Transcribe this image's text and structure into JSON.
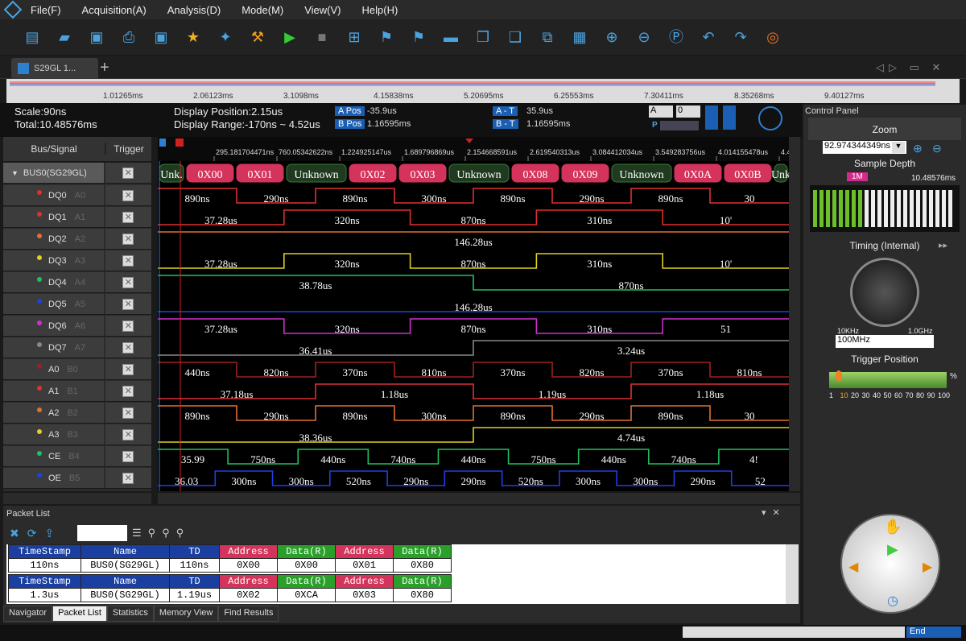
{
  "menu": [
    "File(F)",
    "Acquisition(A)",
    "Analysis(D)",
    "Mode(M)",
    "View(V)",
    "Help(H)"
  ],
  "toolbar_icons": [
    "new-file-icon",
    "open-folder-icon",
    "save-icon",
    "print-icon",
    "save-as-icon",
    "star-icon",
    "settings-icon",
    "tools-icon",
    "run-icon",
    "stop-icon",
    "add-marker-icon",
    "flag-icon",
    "flag-down-icon",
    "flashlight-icon",
    "copy-icon",
    "paste-icon",
    "compare-icon",
    "binary-icon",
    "zoom-in-icon",
    "zoom-out-icon",
    "zoom-fit-icon",
    "undo-icon",
    "redo-icon",
    "help-ring-icon"
  ],
  "tab": {
    "label": "S29GL 1...",
    "plus": "+"
  },
  "overview_ticks": [
    "1.01265ms",
    "2.06123ms",
    "3.1098ms",
    "4.15838ms",
    "5.20695ms",
    "6.25553ms",
    "7.30411ms",
    "8.35268ms",
    "9.40127ms"
  ],
  "info": {
    "scale": "Scale:90ns",
    "total": "Total:10.48576ms",
    "display_position": "Display Position:2.15us",
    "display_range": "Display Range:-170ns ~ 4.52us",
    "a_pos_tag": "A Pos",
    "a_pos": "-35.9us",
    "b_pos_tag": "B Pos",
    "b_pos": "1.16595ms",
    "at_tag": "A - T",
    "at": "35.9us",
    "bt_tag": "B - T",
    "bt": "1.16595ms",
    "sel_a": "A",
    "sel_0": "0",
    "p_label": "P"
  },
  "headers": {
    "bus_signal": "Bus/Signal",
    "trigger": "Trigger"
  },
  "time_ticks": [
    "295.181704471ns",
    "760.05342622ns",
    "1.224925147us",
    "1.689796869us",
    "2.154668591us",
    "2.619540313us",
    "3.084412034us",
    "3.549283756us",
    "4.014155478us",
    "4.4790"
  ],
  "bus": {
    "name": "BUS0(SG29GL)",
    "cells": [
      "Unk.",
      "0X00",
      "0X01",
      "Unknown",
      "0X02",
      "0X03",
      "Unknown",
      "0X08",
      "0X09",
      "Unknown",
      "0X0A",
      "0X0B",
      "Unk"
    ]
  },
  "signals": [
    {
      "name": "DQ0",
      "ch": "A0",
      "color": "#e03030",
      "labels": [
        "890ns",
        "290ns",
        "890ns",
        "300ns",
        "890ns",
        "290ns",
        "890ns",
        "30"
      ]
    },
    {
      "name": "DQ1",
      "ch": "A1",
      "color": "#e03030",
      "labels": [
        "37.28us",
        "320ns",
        "870ns",
        "310ns",
        "10'"
      ]
    },
    {
      "name": "DQ2",
      "ch": "A2",
      "color": "#e07030",
      "labels": [
        "146.28us"
      ]
    },
    {
      "name": "DQ3",
      "ch": "A3",
      "color": "#e0d020",
      "labels": [
        "37.28us",
        "320ns",
        "870ns",
        "310ns",
        "10'"
      ]
    },
    {
      "name": "DQ4",
      "ch": "A4",
      "color": "#20c060",
      "labels": [
        "38.78us",
        "870ns"
      ]
    },
    {
      "name": "DQ5",
      "ch": "A5",
      "color": "#2040e0",
      "labels": [
        "146.28us"
      ]
    },
    {
      "name": "DQ6",
      "ch": "A6",
      "color": "#d030d0",
      "labels": [
        "37.28us",
        "320ns",
        "870ns",
        "310ns",
        "51"
      ]
    },
    {
      "name": "DQ7",
      "ch": "A7",
      "color": "#888888",
      "labels": [
        "36.41us",
        "3.24us"
      ]
    },
    {
      "name": "A0",
      "ch": "B0",
      "color": "#a02020",
      "labels": [
        "440ns",
        "820ns",
        "370ns",
        "810ns",
        "370ns",
        "820ns",
        "370ns",
        "810ns"
      ]
    },
    {
      "name": "A1",
      "ch": "B1",
      "color": "#e03030",
      "labels": [
        "37.18us",
        "1.18us",
        "1.19us",
        "1.18us"
      ]
    },
    {
      "name": "A2",
      "ch": "B2",
      "color": "#e07030",
      "labels": [
        "890ns",
        "290ns",
        "890ns",
        "300ns",
        "890ns",
        "290ns",
        "890ns",
        "30"
      ]
    },
    {
      "name": "A3",
      "ch": "B3",
      "color": "#e0d020",
      "labels": [
        "38.36us",
        "4.74us"
      ]
    },
    {
      "name": "CE",
      "ch": "B4",
      "color": "#20c060",
      "labels": [
        "35.99",
        "750ns",
        "440ns",
        "740ns",
        "440ns",
        "750ns",
        "440ns",
        "740ns",
        "4!"
      ]
    },
    {
      "name": "OE",
      "ch": "B5",
      "color": "#2040e0",
      "labels": [
        "36.03",
        "300ns",
        "300ns",
        "520ns",
        "290ns",
        "290ns",
        "520ns",
        "300ns",
        "300ns",
        "290ns",
        "52"
      ]
    }
  ],
  "control": {
    "title": "Control Panel",
    "zoom": "Zoom",
    "zoom_value": "92.974344349ns",
    "sample_depth": "Sample Depth",
    "depth_tag": "1M",
    "depth_value": "10.48576ms",
    "timing": "Timing (Internal)",
    "khz": "10KHz",
    "ghz": "1.0GHz",
    "rate": "100MHz",
    "trigger_position": "Trigger Position",
    "percent": "%",
    "tp_ticks": [
      "1",
      "10",
      "20",
      "30",
      "40",
      "50",
      "60",
      "70",
      "80",
      "90",
      "100"
    ]
  },
  "packet": {
    "title": "Packet List",
    "rows": [
      {
        "ts_h": "TimeStamp",
        "name_h": "Name",
        "td_h": "TD",
        "ts": "110ns",
        "name": "BUS0(SG29GL)",
        "td": "110ns",
        "cells": [
          {
            "h": "Address",
            "v": "0X00",
            "c": "red"
          },
          {
            "h": "Data(R)",
            "v": "0X00",
            "c": "green"
          },
          {
            "h": "Address",
            "v": "0X01",
            "c": "red"
          },
          {
            "h": "Data(R)",
            "v": "0X80",
            "c": "green"
          }
        ]
      },
      {
        "ts_h": "TimeStamp",
        "name_h": "Name",
        "td_h": "TD",
        "ts": "1.3us",
        "name": "BUS0(SG29GL)",
        "td": "1.19us",
        "cells": [
          {
            "h": "Address",
            "v": "0X02",
            "c": "red"
          },
          {
            "h": "Data(R)",
            "v": "0XCA",
            "c": "green"
          },
          {
            "h": "Address",
            "v": "0X03",
            "c": "red"
          },
          {
            "h": "Data(R)",
            "v": "0X80",
            "c": "green"
          }
        ]
      }
    ]
  },
  "bottom_tabs": [
    "Navigator",
    "Packet List",
    "Statistics",
    "Memory View",
    "Find Results"
  ],
  "status": {
    "end": "End"
  }
}
